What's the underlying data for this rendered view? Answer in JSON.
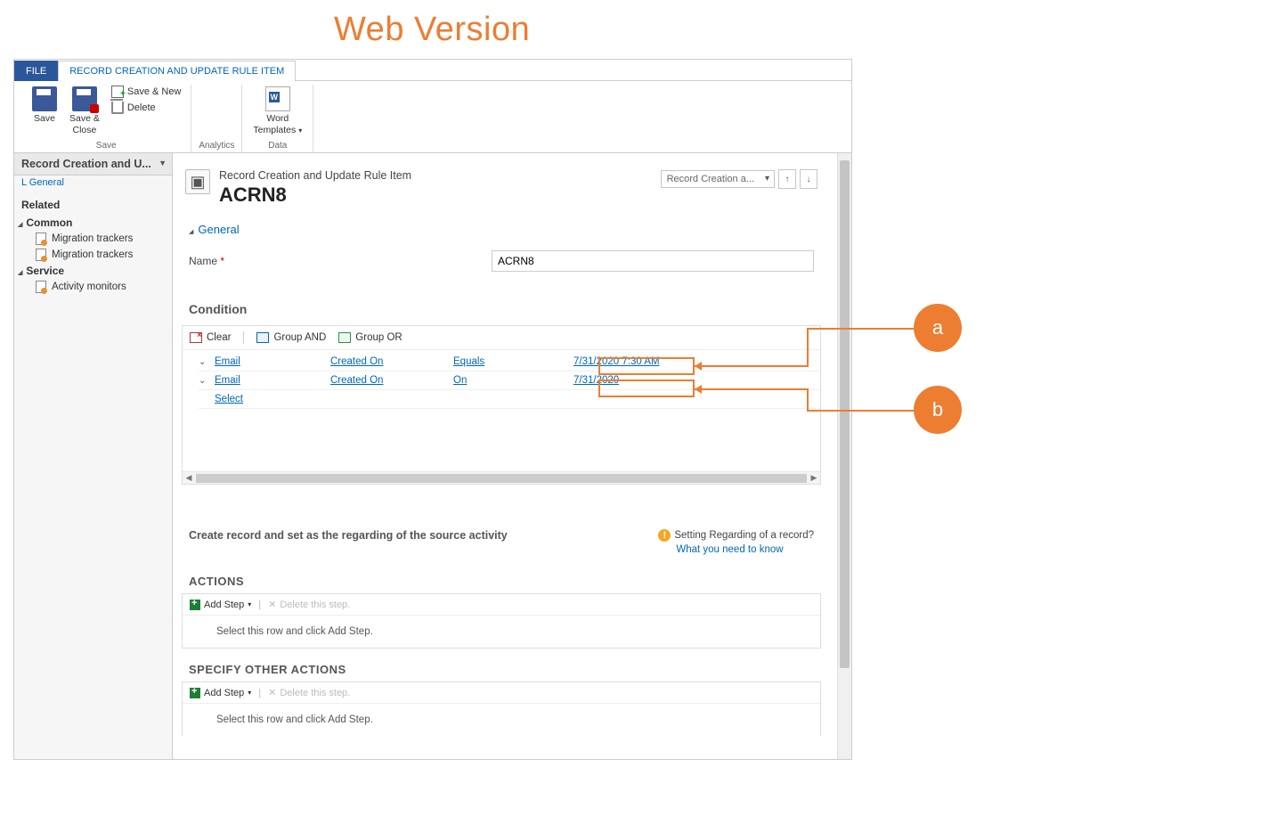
{
  "annotation": {
    "title": "Web Version",
    "callout_a": "a",
    "callout_b": "b"
  },
  "tabs": {
    "file": "FILE",
    "record_rule_item": "RECORD CREATION AND UPDATE RULE ITEM"
  },
  "ribbon": {
    "save": "Save",
    "save_close": "Save &\nClose",
    "save_new": "Save & New",
    "delete": "Delete",
    "group_save": "Save",
    "analytics": "Analytics",
    "word_templates": "Word\nTemplates",
    "group_data": "Data"
  },
  "leftnav": {
    "header": "Record Creation and U...",
    "general_link": "L General",
    "related": "Related",
    "common": "Common",
    "common_items": [
      "Migration trackers",
      "Migration trackers"
    ],
    "service": "Service",
    "service_items": [
      "Activity monitors"
    ]
  },
  "form": {
    "type_label": "Record Creation and Update Rule Item",
    "title": "ACRN8",
    "selector": "Record Creation a...",
    "section_general": "General",
    "name_label": "Name",
    "name_value": "ACRN8",
    "condition_heading": "Condition",
    "cond_toolbar": {
      "clear": "Clear",
      "group_and": "Group AND",
      "group_or": "Group OR"
    },
    "cond_rows": [
      {
        "entity": "Email",
        "field": "Created On",
        "op": "Equals",
        "val": "7/31/2020 7:30 AM"
      },
      {
        "entity": "Email",
        "field": "Created On",
        "op": "On",
        "val": "7/31/2020"
      }
    ],
    "cond_select": "Select",
    "create_record_text": "Create record and set as the regarding of the source activity",
    "info_q": "Setting Regarding of a record?",
    "info_link": "What you need to know",
    "actions_heading": "ACTIONS",
    "specify_heading": "SPECIFY OTHER ACTIONS",
    "add_step": "Add Step",
    "delete_step": "Delete this step.",
    "actions_placeholder": "Select this row and click Add Step."
  }
}
